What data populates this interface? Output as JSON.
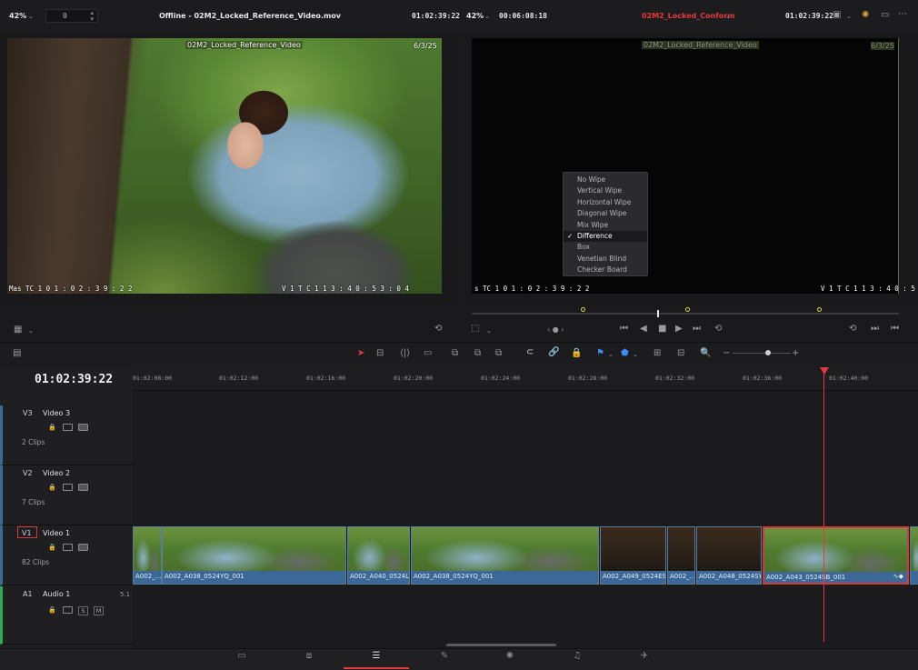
{
  "source_viewer": {
    "zoom": "42%",
    "frame_field": "0",
    "clip_title": "Offline - 02M2_Locked_Reference_Video.mov",
    "timecode": "01:02:39:22",
    "overlay_clip_name": "02M2_Locked_Reference_Video",
    "overlay_date": "6/3/25",
    "overlay_bottom_left": "Mas  TC 1    0 1 : 0 2 : 3 9 : 2 2",
    "overlay_bottom_right": "V 1  T C 1      1 3 : 4 0 : 5 3 : 0 4"
  },
  "timeline_viewer": {
    "zoom": "42%",
    "duration": "00:06:08:18",
    "timeline_name": "02M2_Locked_Conform",
    "timecode": "01:02:39:22",
    "overlay_clip_name": "02M2_Locked_Reference_Video",
    "overlay_date": "6/3/25",
    "overlay_bottom_left": "s   TC 1    0 1 : 0 2 : 3 9 : 2 2",
    "overlay_bottom_right": "V 1  T C 1      1 3 : 4 0 : 5"
  },
  "wipe_menu": {
    "items": [
      "No Wipe",
      "Vertical Wipe",
      "Horizontal Wipe",
      "Diagonal Wipe",
      "Mix Wipe",
      "Difference",
      "Box",
      "Venetian Blind",
      "Checker Board"
    ],
    "selected": "Difference"
  },
  "timeline": {
    "current_timecode": "01:02:39:22",
    "ruler": [
      "01:02:08:00",
      "01:02:12:00",
      "01:02:16:00",
      "01:02:20:00",
      "01:02:24:00",
      "01:02:28:00",
      "01:02:32:00",
      "01:02:36:00",
      "01:02:40:00"
    ],
    "tracks": [
      {
        "id": "V3",
        "name": "Video 3",
        "clips": "2 Clips"
      },
      {
        "id": "V2",
        "name": "Video 2",
        "clips": "7 Clips"
      },
      {
        "id": "V1",
        "name": "Video 1",
        "clips": "82 Clips"
      },
      {
        "id": "A1",
        "name": "Audio 1",
        "format": "5.1",
        "solo": "S",
        "mute": "M"
      }
    ],
    "v1_clips": [
      "A002_...",
      "A002_A038_0524YQ_001",
      "A002_A040_0524L...",
      "A002_A038_0524YQ_001",
      "A002_A049_0524ES...",
      "A002_...",
      "A002_A048_0524SY...",
      "A002_A043_0524SB_001"
    ]
  },
  "colors": {
    "accent_red": "#e23b3b",
    "clip_blue": "#3b6896",
    "selection_red": "#d53a3a",
    "audio_green": "#2faa5a"
  },
  "page_nav_icons": [
    "media-icon",
    "cut-icon",
    "edit-icon",
    "fusion-icon",
    "color-icon",
    "fairlight-icon",
    "deliver-icon"
  ]
}
